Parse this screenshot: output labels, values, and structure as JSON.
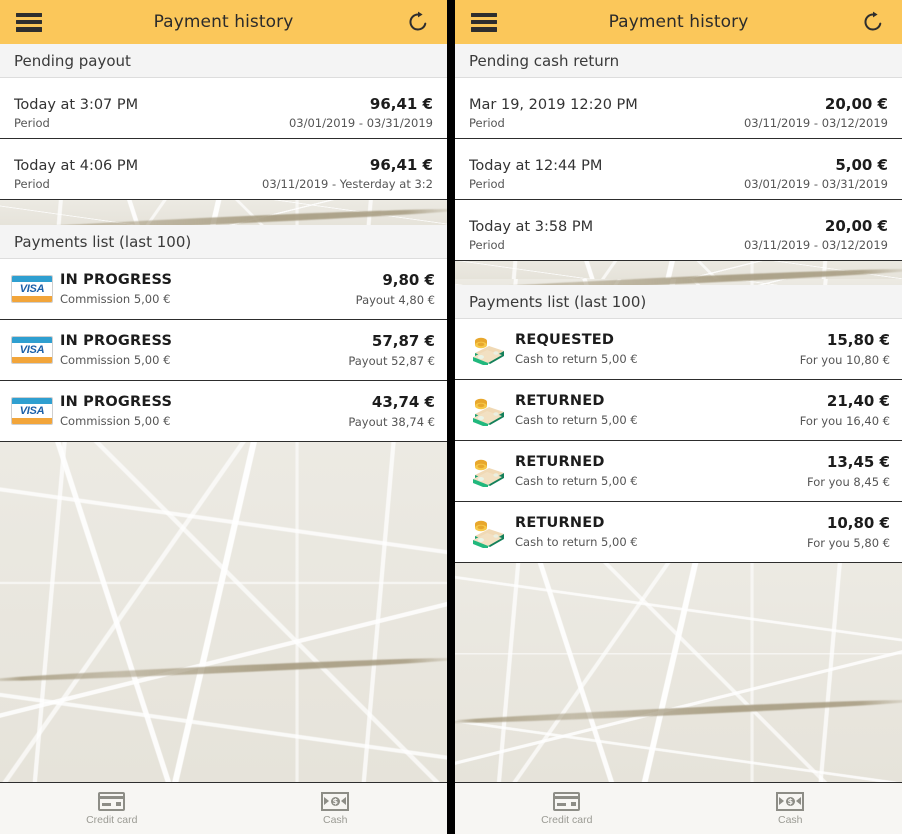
{
  "appbar": {
    "title": "Payment history",
    "menu_icon": "hamburger-menu-icon",
    "refresh_icon": "refresh-icon"
  },
  "left_panel": {
    "pending_section": {
      "header": "Pending payout",
      "rows": [
        {
          "date": "Today at 3:07 PM",
          "amount": "96,41 €",
          "label": "Period",
          "period": "03/01/2019 - 03/31/2019"
        },
        {
          "date": "Today at 4:06 PM",
          "amount": "96,41 €",
          "label": "Period",
          "period": "03/11/2019 - Yesterday at 3:2"
        }
      ]
    },
    "payments_section": {
      "header": "Payments list (last 100)",
      "rows": [
        {
          "icon": "visa-card-icon",
          "status": "IN PROGRESS",
          "sub": "Commission 5,00 €",
          "amount": "9,80 €",
          "note": "Payout 4,80 €"
        },
        {
          "icon": "visa-card-icon",
          "status": "IN PROGRESS",
          "sub": "Commission 5,00 €",
          "amount": "57,87 €",
          "note": "Payout 52,87 €"
        },
        {
          "icon": "visa-card-icon",
          "status": "IN PROGRESS",
          "sub": "Commission 5,00 €",
          "amount": "43,74 €",
          "note": "Payout 38,74 €"
        }
      ]
    }
  },
  "right_panel": {
    "pending_section": {
      "header": "Pending cash return",
      "rows": [
        {
          "date": "Mar 19, 2019 12:20 PM",
          "amount": "20,00 €",
          "label": "Period",
          "period": "03/11/2019 - 03/12/2019"
        },
        {
          "date": "Today at 12:44 PM",
          "amount": "5,00 €",
          "label": "Period",
          "period": "03/01/2019 - 03/31/2019"
        },
        {
          "date": "Today at 3:58 PM",
          "amount": "20,00 €",
          "label": "Period",
          "period": "03/11/2019 - 03/12/2019"
        }
      ]
    },
    "payments_section": {
      "header": "Payments list (last 100)",
      "rows": [
        {
          "icon": "cash-bundle-icon",
          "status": "REQUESTED",
          "sub": "Cash to return 5,00 €",
          "amount": "15,80 €",
          "note": "For you 10,80 €"
        },
        {
          "icon": "cash-bundle-icon",
          "status": "RETURNED",
          "sub": "Cash to return 5,00 €",
          "amount": "21,40 €",
          "note": "For you 16,40 €"
        },
        {
          "icon": "cash-bundle-icon",
          "status": "RETURNED",
          "sub": "Cash to return 5,00 €",
          "amount": "13,45 €",
          "note": "For you 8,45 €"
        },
        {
          "icon": "cash-bundle-icon",
          "status": "RETURNED",
          "sub": "Cash to return 5,00 €",
          "amount": "10,80 €",
          "note": "For you 5,80 €"
        }
      ]
    }
  },
  "bottom_nav": {
    "items": [
      {
        "icon": "credit-card-icon",
        "label": "Credit card"
      },
      {
        "icon": "cash-bill-icon",
        "label": "Cash"
      }
    ]
  },
  "colors": {
    "appbar_background": "#fbc75a",
    "section_header_background": "#f4f4f4",
    "row_background": "#ffffff",
    "map_background": "#e9e6de",
    "bottom_nav_background": "#f7f6f3",
    "text_primary": "#1c1c1c",
    "text_secondary": "#555555",
    "visa_blue": "#2f9fd0",
    "visa_orange": "#f2a53a"
  }
}
